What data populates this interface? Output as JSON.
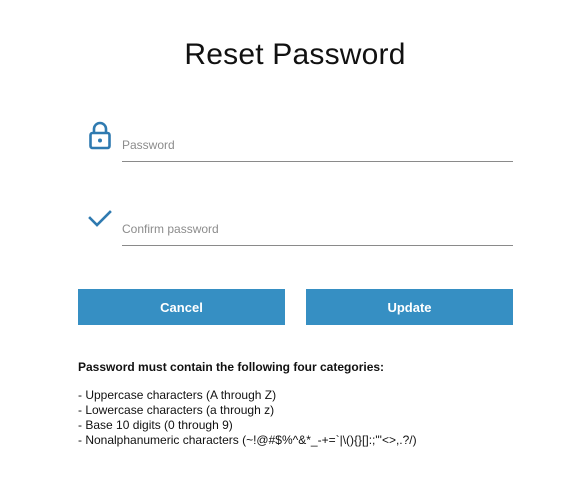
{
  "title": "Reset Password",
  "fields": {
    "password": {
      "placeholder": "Password",
      "value": "",
      "icon": "lock-icon"
    },
    "confirm": {
      "placeholder": "Confirm password",
      "value": "",
      "icon": "check-icon"
    }
  },
  "buttons": {
    "cancel_label": "Cancel",
    "update_label": "Update"
  },
  "rules": {
    "heading": "Password must contain the following four categories:",
    "items": [
      "- Uppercase characters (A through Z)",
      "- Lowercase characters (a through z)",
      "- Base 10 digits (0 through 9)",
      "- Nonalphanumeric characters (~!@#$%^&*_-+=`|\\(){}[]:;\"'<>,.?/)"
    ]
  },
  "colors": {
    "accent": "#368fc3",
    "icon": "#2f7ab0"
  }
}
